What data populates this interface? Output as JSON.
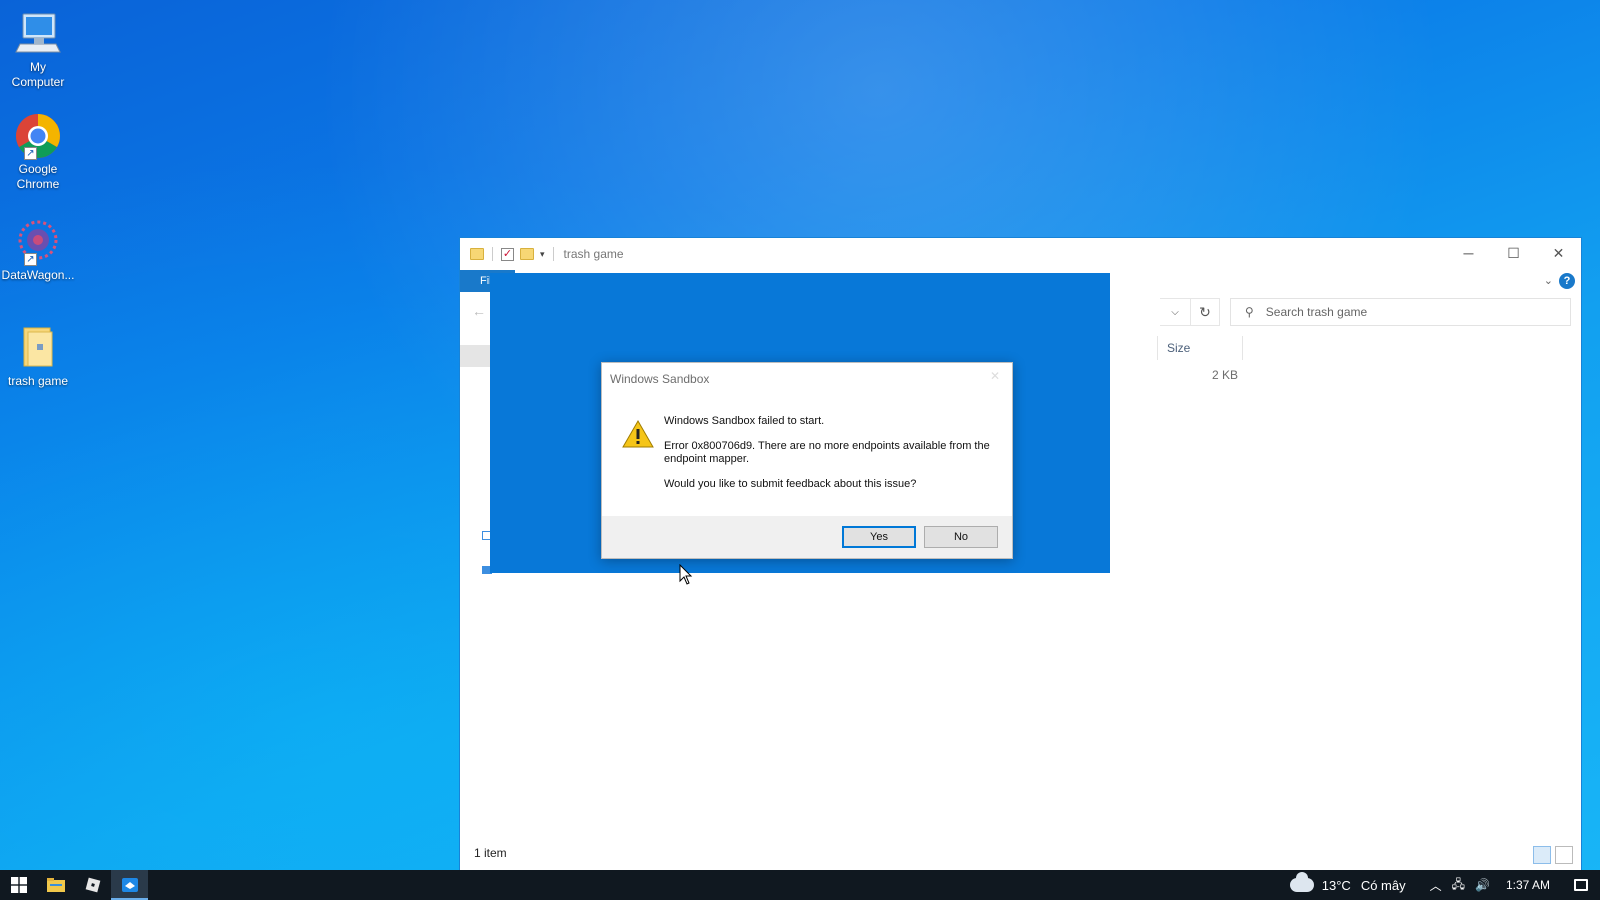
{
  "desktop": {
    "icons": [
      {
        "label": "My\nComputer",
        "icon": "computer-icon"
      },
      {
        "label": "Google\nChrome",
        "icon": "chrome-icon"
      },
      {
        "label": "DataWagon...",
        "icon": "datawagon-icon"
      },
      {
        "label": "trash game",
        "icon": "folder-icon"
      }
    ]
  },
  "explorer": {
    "title": "trash game",
    "file_tab": "Fil",
    "help": "?",
    "search_placeholder": "Search trash game",
    "column_size": "Size",
    "file_size": "2 KB",
    "status": "1 item"
  },
  "dialog": {
    "title": "Windows Sandbox",
    "heading": "Windows Sandbox failed to start.",
    "error": "Error 0x800706d9. There are no more endpoints available from the endpoint mapper.",
    "question": "Would you like to submit feedback about this issue?",
    "yes_label": "Yes",
    "no_label": "No"
  },
  "taskbar": {
    "temperature": "13°C",
    "weather": "Có mây",
    "time": "1:37 AM"
  },
  "colors": {
    "accent": "#0078d7",
    "sandbox_blue": "#0878d8",
    "taskbar": "#101820"
  }
}
